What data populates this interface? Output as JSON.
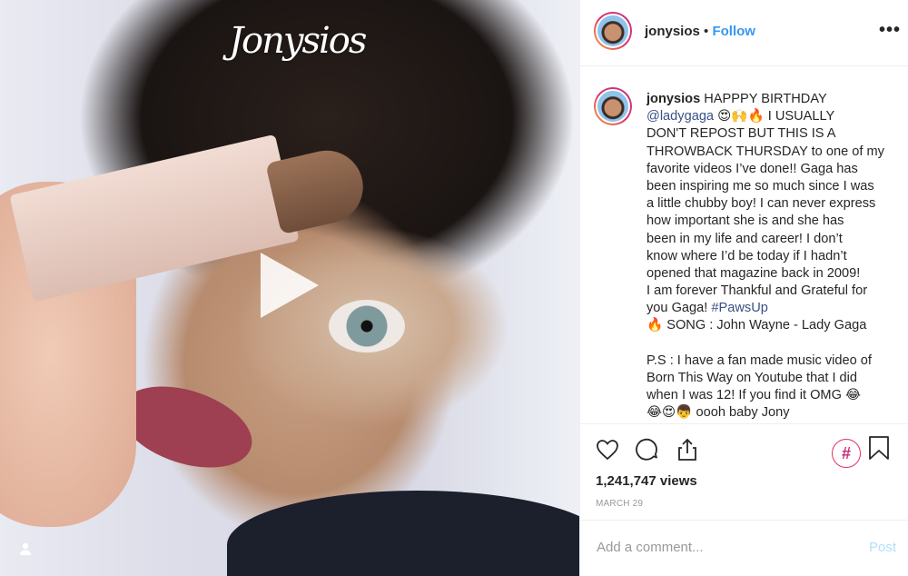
{
  "media": {
    "watermark": "Jonysios"
  },
  "header": {
    "username": "jonysios",
    "separator": "•",
    "follow": "Follow",
    "more": "•••"
  },
  "caption": {
    "lines": [
      [
        {
          "t": "jonysios",
          "s": "b"
        },
        {
          "t": " HAPPPY BIRTHDAY"
        }
      ],
      [
        {
          "t": "@ladygaga",
          "s": "lnk"
        },
        {
          "t": " 😍🙌🔥 I USUALLY"
        }
      ],
      [
        {
          "t": "DON'T REPOST BUT THIS IS A"
        }
      ],
      [
        {
          "t": "THROWBACK THURSDAY to one of my"
        }
      ],
      [
        {
          "t": "favorite videos I’ve done!! Gaga has"
        }
      ],
      [
        {
          "t": "been inspiring me so much since I was"
        }
      ],
      [
        {
          "t": "a little chubby boy! I can never express"
        }
      ],
      [
        {
          "t": "how important she is and she has"
        }
      ],
      [
        {
          "t": "been in my life and career! I don’t"
        }
      ],
      [
        {
          "t": "know where I’d be today if I hadn’t"
        }
      ],
      [
        {
          "t": "opened that magazine back in 2009!"
        }
      ],
      [
        {
          "t": "I am forever Thankful and Grateful for"
        }
      ],
      [
        {
          "t": "you Gaga! "
        },
        {
          "t": "#PawsUp",
          "s": "lnk"
        }
      ],
      [
        {
          "t": "🔥 SONG : John Wayne - Lady Gaga"
        }
      ],
      [
        {
          "t": ""
        }
      ],
      [
        {
          "t": "P.S : I have a fan made music video of"
        }
      ],
      [
        {
          "t": "Born This Way on Youtube that I did"
        }
      ],
      [
        {
          "t": "when I was 12! If you find it OMG 😂"
        }
      ],
      [
        {
          "t": "😂😍👦 oooh baby Jony"
        }
      ]
    ]
  },
  "stats": {
    "views": "1,241,747 views",
    "date": "MARCH 29",
    "hashtag": "#"
  },
  "comment": {
    "placeholder": "Add a comment...",
    "post": "Post"
  }
}
